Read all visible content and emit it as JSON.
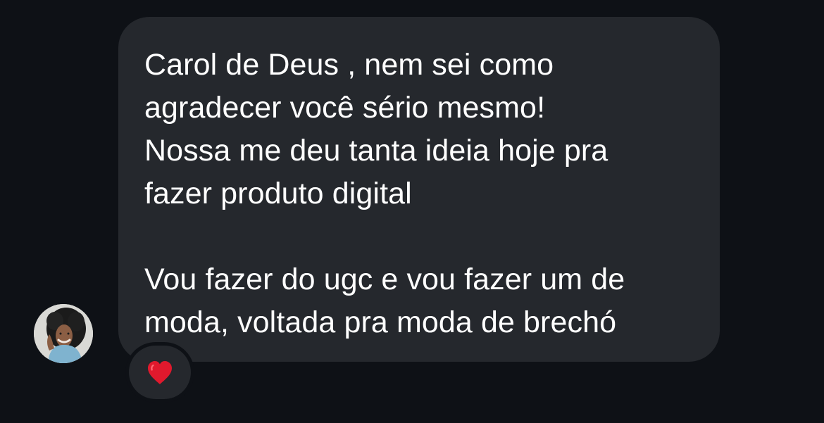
{
  "conversation": {
    "avatar": {
      "icon": "woman-portrait-avatar"
    },
    "message": {
      "lines": [
        "Carol de Deus , nem sei como",
        "agradecer você sério mesmo!",
        "Nossa me deu tanta ideia hoje pra",
        "fazer produto digital",
        "",
        "Vou fazer do ugc e vou fazer um de",
        "moda, voltada pra moda de brechó"
      ]
    },
    "reaction": {
      "icon": "red-heart-icon",
      "color": "#e0192d"
    }
  },
  "colors": {
    "background": "#0e1116",
    "bubble": "#25282d",
    "text": "#ffffff"
  }
}
